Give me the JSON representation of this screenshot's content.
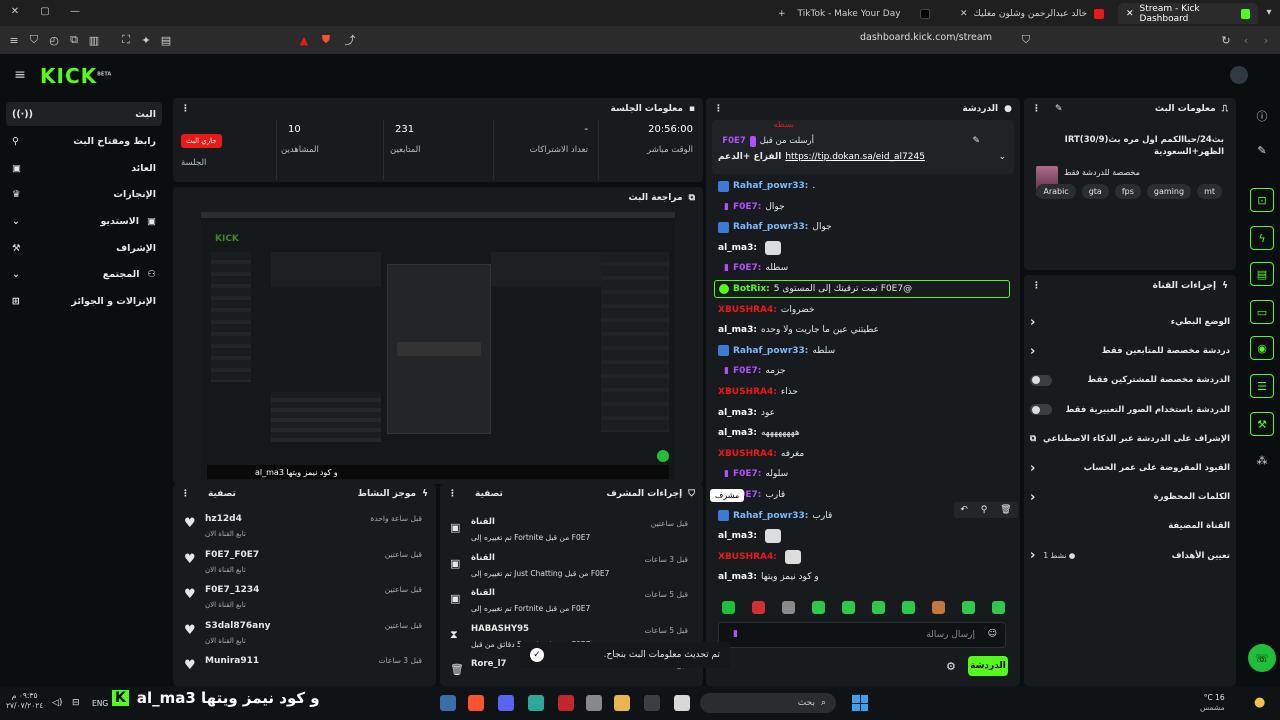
{
  "browser": {
    "tabs": [
      {
        "label": "Stream - Kick Dashboard",
        "active": true
      },
      {
        "label": "اغنية خالد عبدالرحمن وشلون مغليك -",
        "active": false
      },
      {
        "label": "TikTok - Make Your Day",
        "active": false
      }
    ],
    "url": "dashboard.kick.com/stream"
  },
  "header": {
    "logo": "KICK",
    "logo_sup": "BETA"
  },
  "sidebar": {
    "items": [
      {
        "label": "البث",
        "icon": "broadcast-icon"
      },
      {
        "label": "رابط ومفتاح البث",
        "icon": "key-icon"
      },
      {
        "label": "العائد",
        "icon": "money-icon"
      },
      {
        "label": "الإنجازات",
        "icon": "trophy-icon"
      },
      {
        "label": "الاستديو",
        "icon": "studio-icon"
      },
      {
        "label": "الإشراف",
        "icon": "hammer-icon"
      },
      {
        "label": "المجتمع",
        "icon": "community-icon"
      },
      {
        "label": "الإنزالات و الجوائز",
        "icon": "gift-icon"
      }
    ]
  },
  "session": {
    "title": "معلومات الجلسة",
    "stats": [
      {
        "label": "الوقت مباشر",
        "value": "20:56:00"
      },
      {
        "label": "تعداد الاشتراكات",
        "value": "-"
      },
      {
        "label": "المتابعين",
        "value": "231"
      },
      {
        "label": "المشاهدين",
        "value": "10"
      },
      {
        "label": "الجلسة",
        "value": "جاري البث"
      }
    ]
  },
  "preview": {
    "title": "مراجعة البث",
    "overlay_text": "al_ma3 و كود نيمز ويتها"
  },
  "activity": {
    "title": "موجز النشاط",
    "filter": "تصفية",
    "items": [
      {
        "name": "hz12d4",
        "sub": "تابع القناة الان",
        "time": "قبل ساعة واحدة"
      },
      {
        "name": "F0E7_F0E7",
        "sub": "تابع القناة الان",
        "time": "قبل ساعتين"
      },
      {
        "name": "F0E7_1234",
        "sub": "تابع القناة الان",
        "time": "قبل ساعتين"
      },
      {
        "name": "S3dal876any",
        "sub": "تابع القناة الان",
        "time": "قبل ساعتين"
      },
      {
        "name": "Munira911",
        "sub": "",
        "time": "قبل 3 ساعات"
      }
    ]
  },
  "modactions": {
    "title": "إجراءات المشرف",
    "filter": "تصفية",
    "items": [
      {
        "name": "القناة",
        "sub": "تم تغييره إلى Fortnite من قبل F0E7",
        "time": "قبل ساعتين"
      },
      {
        "name": "القناة",
        "sub": "تم تغييره إلى Just Chatting من قبل F0E7",
        "time": "قبل 3 ساعات"
      },
      {
        "name": "القناة",
        "sub": "تم تغييره إلى Fortnite من قبل F0E7",
        "time": "قبل 5 ساعات"
      },
      {
        "name": "HABASHY95",
        "sub": "تم حظره لمدة 5 دقائق من قبل F0E7",
        "time": "قبل 5 ساعات"
      },
      {
        "name": "Rore_l7",
        "sub": "",
        "time": "قبل 5 ساعات"
      }
    ]
  },
  "chat": {
    "title": "الدردشة",
    "pinned": {
      "by": "F0E7",
      "label": "أرسلت من قبل",
      "text": "الفزاع +الدعم",
      "link": "https://tip.dokan.sa/eid_al7245",
      "top": "بسطه"
    },
    "messages": [
      {
        "user": "XBUSHRA4",
        "text": "بسطه",
        "color": "#e91916"
      },
      {
        "user": "Rahaf_powr33",
        "text": ".",
        "color": "#7ab8ff"
      },
      {
        "user": "F0E7",
        "text": "جوال",
        "color": "#b14fff"
      },
      {
        "user": "Rahaf_powr33",
        "text": "جوال",
        "color": "#7ab8ff"
      },
      {
        "user": "al_ma3",
        "text": "",
        "color": "#ffffff"
      },
      {
        "user": "F0E7",
        "text": "سطله",
        "color": "#b14fff"
      },
      {
        "user": "BotRix",
        "text": "@F0E7 تمت ترقيتك إلى المستوى 5",
        "color": "#ffffff"
      },
      {
        "user": "XBUSHRA4",
        "text": "خضروات",
        "color": "#e91916"
      },
      {
        "user": "al_ma3",
        "text": "عطيتني عين ما جاريت ولا وحده",
        "color": "#ffffff"
      },
      {
        "user": "Rahaf_powr33",
        "text": "سلطه",
        "color": "#7ab8ff"
      },
      {
        "user": "F0E7",
        "text": "جزمه",
        "color": "#b14fff"
      },
      {
        "user": "XBUSHRA4",
        "text": "حذاء",
        "color": "#e91916"
      },
      {
        "user": "al_ma3",
        "text": "عود",
        "color": "#ffffff"
      },
      {
        "user": "al_ma3",
        "text": "ههههههههه",
        "color": "#ffffff"
      },
      {
        "user": "XBUSHRA4",
        "text": "مغرفه",
        "color": "#e91916"
      },
      {
        "user": "F0E7",
        "text": "سلوله",
        "color": "#b14fff"
      },
      {
        "user": "F0E7",
        "text": "قارب",
        "color": "#b14fff"
      },
      {
        "user": "Rahaf_powr33",
        "text": "قارب",
        "color": "#7ab8ff"
      },
      {
        "user": "al_ma3",
        "text": "",
        "color": "#ffffff"
      },
      {
        "user": "XBUSHRA4",
        "text": "",
        "color": "#e91916"
      },
      {
        "user": "al_ma3",
        "text": "و كود نيمز ويتها",
        "color": "#ffffff"
      }
    ],
    "tooltip": "مشرف",
    "input_placeholder": "إرسال رسالة",
    "send_label": "الدردشة"
  },
  "streaminfo": {
    "title": "معلومات البث",
    "stream_title": "بث24/حياالكمم اول مره بث(30/9)IRT الظهر+السعودية",
    "category": "مخصصة للدردشة فقط",
    "tags": [
      "mt",
      "gaming",
      "fps",
      "gta",
      "Arabic"
    ]
  },
  "channel_actions": {
    "title": "إجراءات القناة",
    "items": [
      {
        "label": "الوضع البطيء",
        "type": "arrow"
      },
      {
        "label": "دردشة مخصصة للمتابعين فقط",
        "type": "arrow"
      },
      {
        "label": "الدردشة مخصصة للمشتركين فقط",
        "type": "toggle"
      },
      {
        "label": "الدردشة باستخدام الصور التعبيرية فقط",
        "type": "toggle"
      },
      {
        "label": "الإشراف على الدردشة عبر الذكاء الاصطناعي",
        "type": "ext"
      },
      {
        "label": "القيود المفروضة على عمر الحساب",
        "type": "arrow"
      },
      {
        "label": "الكلمات المحظورة",
        "type": "arrow"
      },
      {
        "label": "القناة المضيفة",
        "type": "none"
      },
      {
        "label": "تعيين الأهداف",
        "type": "arrow",
        "extra": "نشط 1"
      }
    ]
  },
  "toast": "تم تحديث معلومات البث بنجاح.",
  "taskbar": {
    "search": "بحث",
    "weather": "°C 16",
    "weather_sub": "مشمس",
    "time": "٠٩:٣٥ م",
    "date": "٢٧/٠٧/٢٠٢٤",
    "lang": "ENG",
    "overlay": "al_ma3 و كود نيمز ويتها"
  },
  "colors": {
    "accent": "#53fc18",
    "live": "#e91916",
    "panel": "#181b1d",
    "bg": "#0b0e0f"
  }
}
